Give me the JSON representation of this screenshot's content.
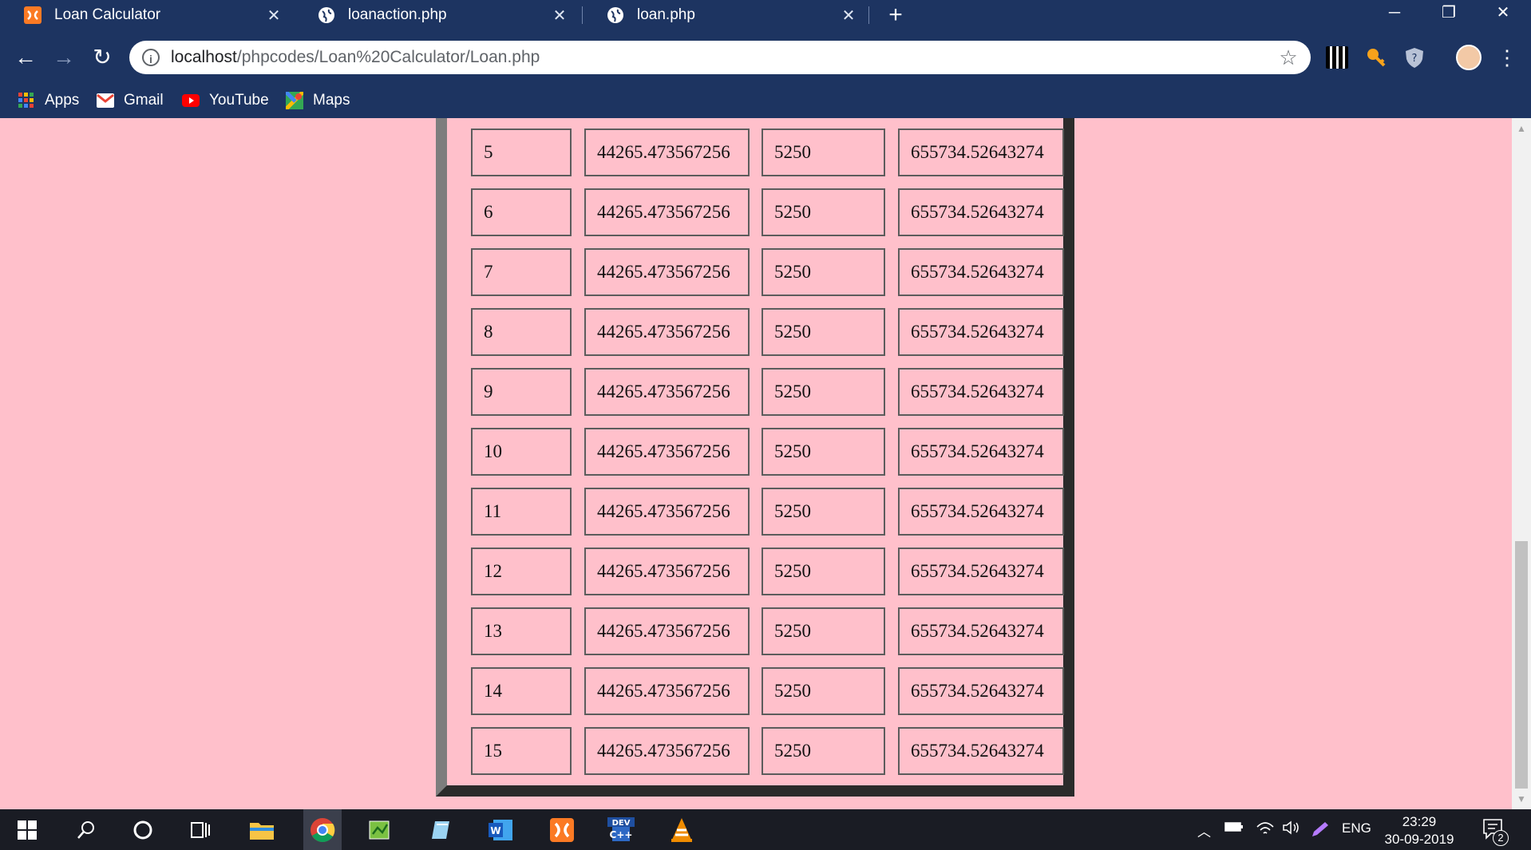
{
  "browser": {
    "tabs": [
      {
        "title": "Loan Calculator",
        "active": true,
        "icon": "xampp-icon"
      },
      {
        "title": "loanaction.php",
        "active": false,
        "icon": "globe-icon"
      },
      {
        "title": "loan.php",
        "active": false,
        "icon": "globe-icon"
      }
    ],
    "new_tab_label": "+",
    "url_host": "localhost",
    "url_path": "/phpcodes/Loan%20Calculator/Loan.php",
    "bookmarks": [
      {
        "label": "Apps",
        "icon": "apps-grid-icon"
      },
      {
        "label": "Gmail",
        "icon": "gmail-icon"
      },
      {
        "label": "YouTube",
        "icon": "youtube-icon"
      },
      {
        "label": "Maps",
        "icon": "maps-icon"
      }
    ]
  },
  "table": {
    "rows": [
      {
        "month": "5",
        "payment": "44265.473567256",
        "interest": "5250",
        "balance": "655734.52643274"
      },
      {
        "month": "6",
        "payment": "44265.473567256",
        "interest": "5250",
        "balance": "655734.52643274"
      },
      {
        "month": "7",
        "payment": "44265.473567256",
        "interest": "5250",
        "balance": "655734.52643274"
      },
      {
        "month": "8",
        "payment": "44265.473567256",
        "interest": "5250",
        "balance": "655734.52643274"
      },
      {
        "month": "9",
        "payment": "44265.473567256",
        "interest": "5250",
        "balance": "655734.52643274"
      },
      {
        "month": "10",
        "payment": "44265.473567256",
        "interest": "5250",
        "balance": "655734.52643274"
      },
      {
        "month": "11",
        "payment": "44265.473567256",
        "interest": "5250",
        "balance": "655734.52643274"
      },
      {
        "month": "12",
        "payment": "44265.473567256",
        "interest": "5250",
        "balance": "655734.52643274"
      },
      {
        "month": "13",
        "payment": "44265.473567256",
        "interest": "5250",
        "balance": "655734.52643274"
      },
      {
        "month": "14",
        "payment": "44265.473567256",
        "interest": "5250",
        "balance": "655734.52643274"
      },
      {
        "month": "15",
        "payment": "44265.473567256",
        "interest": "5250",
        "balance": "655734.52643274"
      }
    ]
  },
  "taskbar": {
    "language": "ENG",
    "time": "23:29",
    "date": "30-09-2019",
    "notification_count": "2"
  },
  "colors": {
    "page_background": "#ffc0cb",
    "browser_frame": "#1d3461",
    "taskbar": "#1a1c24"
  }
}
